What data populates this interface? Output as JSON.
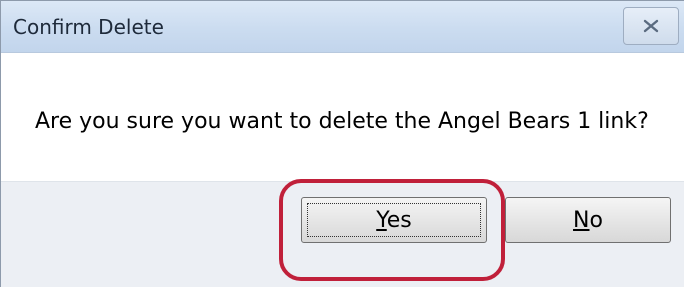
{
  "window": {
    "title": "Confirm Delete",
    "close_icon": "close-icon"
  },
  "message": {
    "text": "Are you sure you want to delete the Angel Bears 1 link?"
  },
  "buttons": {
    "yes": {
      "mnemonic": "Y",
      "rest": "es"
    },
    "no": {
      "mnemonic": "N",
      "rest": "o"
    }
  },
  "annotation": {
    "highlight_color": "#c0203a",
    "highlight_target": "yes-button"
  },
  "colors": {
    "titlebar": "#cbdcf0",
    "footer": "#eceff4"
  }
}
